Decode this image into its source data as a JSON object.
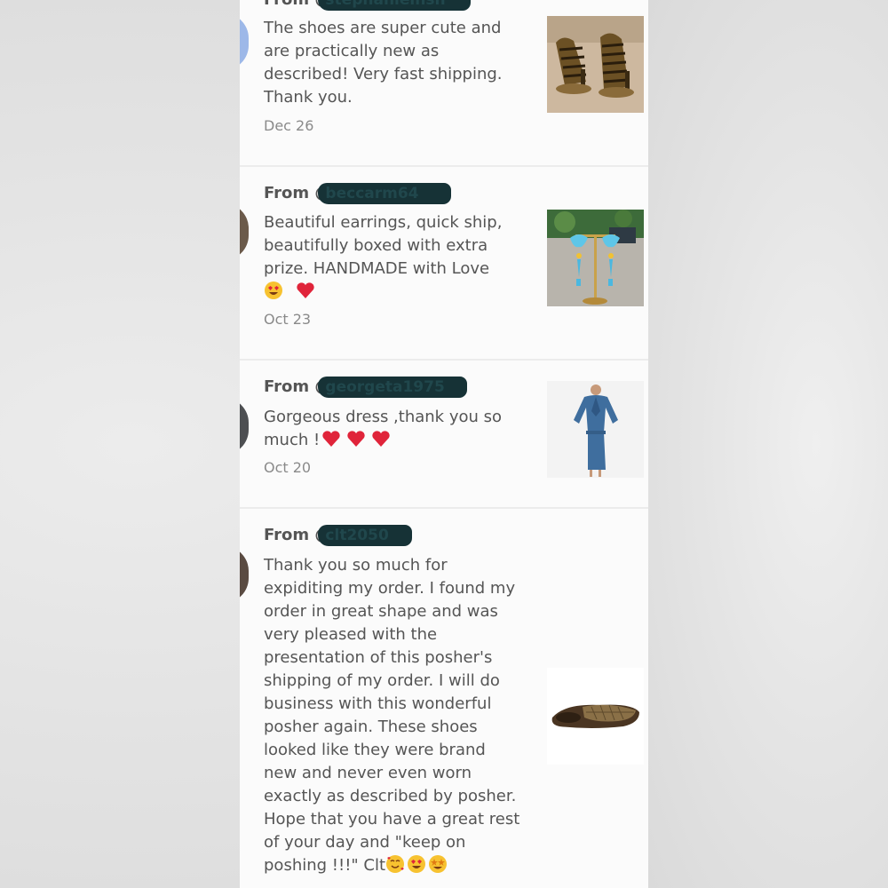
{
  "reviews": [
    {
      "from_prefix": "From @",
      "username": "stephanieinsh",
      "text": "The shoes are super cute and are practically new as described! Very fast shipping. Thank you.",
      "date": "Dec 26",
      "thumb_icon": "caged-heels-photo"
    },
    {
      "from_prefix": "From @",
      "username": "beccarm64",
      "text": "Beautiful earrings, quick ship, beautifully boxed with extra prize. HANDMADE with Love",
      "emojis": [
        "heart-eyes-emoji",
        "red-heart-emoji"
      ],
      "date": "Oct 23",
      "thumb_icon": "earrings-photo"
    },
    {
      "from_prefix": "From @",
      "username": "georgeta1975",
      "text": "Gorgeous dress ,thank you so much !",
      "emojis": [
        "red-heart-emoji",
        "red-heart-emoji",
        "red-heart-emoji"
      ],
      "date": "Oct 20",
      "thumb_icon": "blue-dress-photo"
    },
    {
      "from_prefix": "From @",
      "username": "clt2050",
      "text": "Thank you so much for expiditing my order. I found my order in great shape and was very pleased with the presentation of this posher's shipping of my order. I will do business with this wonderful posher again. These shoes looked like they were brand new and never even worn exactly as described by posher. Hope that you have a great rest of your day and \"keep on poshing !!!\" Clt",
      "emojis": [
        "smiling-hearts-emoji",
        "heart-eyes-emoji",
        "star-struck-emoji"
      ],
      "date": "",
      "thumb_icon": "ballet-flat-photo"
    }
  ]
}
